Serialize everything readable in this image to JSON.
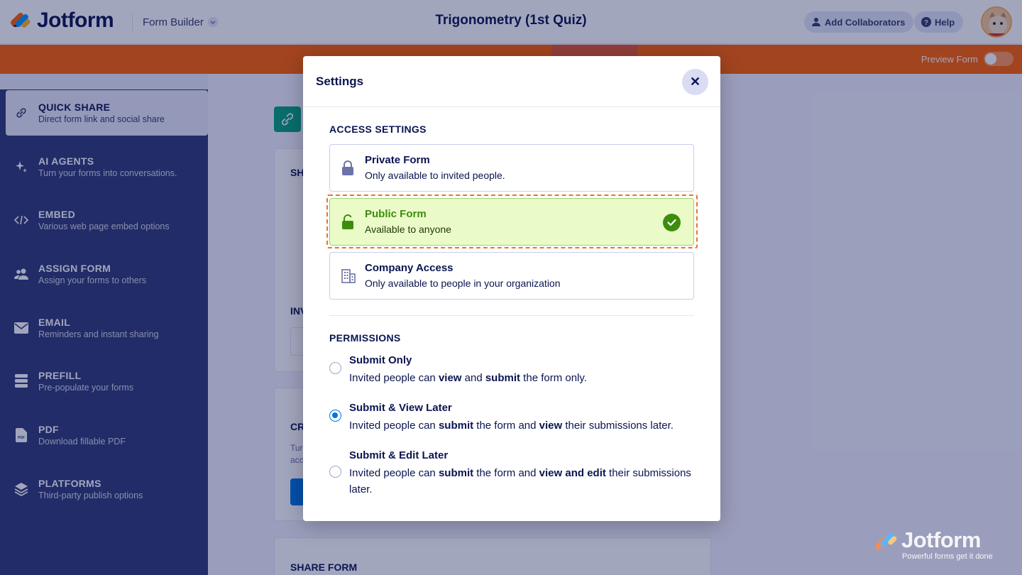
{
  "app": {
    "logo_text": "Jotform",
    "mode_label": "Form Builder",
    "form_title": "Trigonometry (1st Quiz)",
    "add_collaborators": "Add Collaborators",
    "help": "Help"
  },
  "tabs": {
    "preview_label": "Preview Form"
  },
  "sidebar": {
    "items": [
      {
        "title": "QUICK SHARE",
        "desc": "Direct form link and social share"
      },
      {
        "title": "AI AGENTS",
        "desc": "Turn your forms into conversations."
      },
      {
        "title": "EMBED",
        "desc": "Various web page embed options"
      },
      {
        "title": "ASSIGN FORM",
        "desc": "Assign your forms to others"
      },
      {
        "title": "EMAIL",
        "desc": "Reminders and instant sharing"
      },
      {
        "title": "PREFILL",
        "desc": "Pre-populate your forms"
      },
      {
        "title": "PDF",
        "desc": "Download fillable PDF"
      },
      {
        "title": "PLATFORMS",
        "desc": "Third-party publish options"
      }
    ]
  },
  "background": {
    "share_heading_partial": "SH",
    "invite_heading_partial": "INV",
    "create_heading_partial": "CR",
    "create_text_line1": "Tur",
    "create_text_line2": "acc",
    "share_form_heading": "SHARE FORM"
  },
  "watermark": {
    "title": "Jotform",
    "subtitle": "Powerful forms get it done"
  },
  "modal": {
    "title": "Settings",
    "close_symbol": "✕",
    "access_heading": "ACCESS SETTINGS",
    "access_options": [
      {
        "title": "Private Form",
        "desc": "Only available to invited people.",
        "selected": false
      },
      {
        "title": "Public Form",
        "desc": "Available to anyone",
        "selected": true
      },
      {
        "title": "Company Access",
        "desc": "Only available to people in your organization",
        "selected": false
      }
    ],
    "permissions_heading": "PERMISSIONS",
    "permissions": [
      {
        "title": "Submit Only",
        "desc_parts": [
          "Invited people can ",
          "view",
          " and ",
          "submit",
          " the form only."
        ],
        "selected": false
      },
      {
        "title": "Submit & View Later",
        "desc_parts": [
          "Invited people can ",
          "submit",
          " the form and ",
          "view",
          " their submissions later."
        ],
        "selected": true
      },
      {
        "title": "Submit & Edit Later",
        "desc_parts": [
          "Invited people can ",
          "submit",
          " the form and ",
          "view and edit",
          " their submissions later."
        ],
        "selected": false
      }
    ]
  },
  "colors": {
    "accent_orange": "#ff6100",
    "navy": "#0a1551",
    "sidebar_bg": "#2f3b77",
    "selected_green": "#3c8d0e",
    "radio_blue": "#0075e3"
  }
}
